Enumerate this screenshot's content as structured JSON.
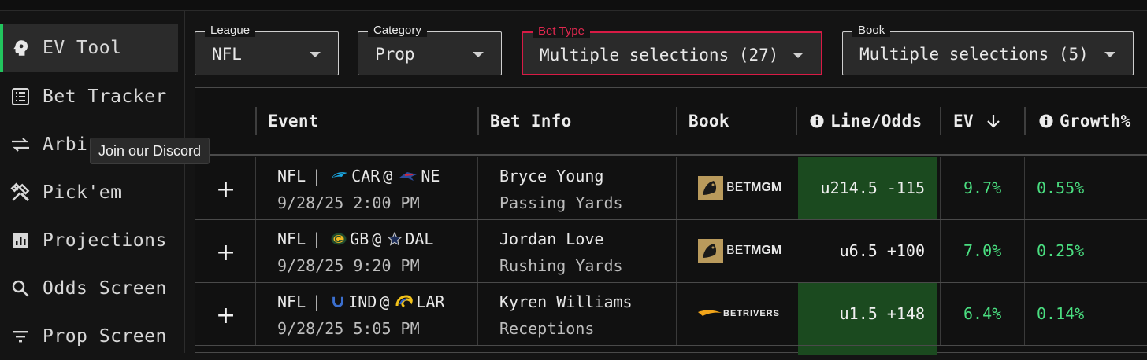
{
  "nav": {
    "items": [
      {
        "label": "EV Tool",
        "icon": "brain-head-icon",
        "active": true
      },
      {
        "label": "Bet Tracker",
        "icon": "list-icon"
      },
      {
        "label": "Arbi",
        "icon": "swap-arrows-icon"
      },
      {
        "label": "Pick'em",
        "icon": "tools-icon"
      },
      {
        "label": "Projections",
        "icon": "bar-chart-icon"
      },
      {
        "label": "Odds Screen",
        "icon": "search-icon"
      },
      {
        "label": "Prop Screen",
        "icon": "filter-icon"
      }
    ],
    "tooltip": "Join our Discord"
  },
  "filters": {
    "league": {
      "label": "League",
      "value": "NFL"
    },
    "category": {
      "label": "Category",
      "value": "Prop"
    },
    "bet_type": {
      "label": "Bet Type",
      "value": "Multiple selections (27)"
    },
    "book": {
      "label": "Book",
      "value": "Multiple selections (5)"
    }
  },
  "table": {
    "headers": {
      "event": "Event",
      "bet_info": "Bet Info",
      "book": "Book",
      "line_odds": "Line/Odds",
      "ev": "EV",
      "growth": "Growth%"
    },
    "rows": [
      {
        "league": "NFL",
        "away": "CAR",
        "home": "NE",
        "time": "9/28/25 2:00 PM",
        "player": "Bryce Young",
        "market": "Passing Yards",
        "book": "BETMGM",
        "line": "u214.5",
        "odds": "-115",
        "ev": "9.7%",
        "growth": "0.55%",
        "highlight": true
      },
      {
        "league": "NFL",
        "away": "GB",
        "home": "DAL",
        "time": "9/28/25 9:20 PM",
        "player": "Jordan Love",
        "market": "Rushing Yards",
        "book": "BETMGM",
        "line": "u6.5",
        "odds": "+100",
        "ev": "7.0%",
        "growth": "0.25%",
        "highlight": false
      },
      {
        "league": "NFL",
        "away": "IND",
        "home": "LAR",
        "time": "9/28/25 5:05 PM",
        "player": "Kyren Williams",
        "market": "Receptions",
        "book": "BETRIVERS",
        "line": "u1.5",
        "odds": "+148",
        "ev": "6.4%",
        "growth": "0.14%",
        "highlight": true
      }
    ]
  },
  "separators": {
    "pipe": "|",
    "at": "@"
  },
  "colors": {
    "accent_green": "#22c55e",
    "ev_green": "#4ade80",
    "highlight_red": "#d81b45",
    "odds_bg": "#1b4a1f"
  }
}
